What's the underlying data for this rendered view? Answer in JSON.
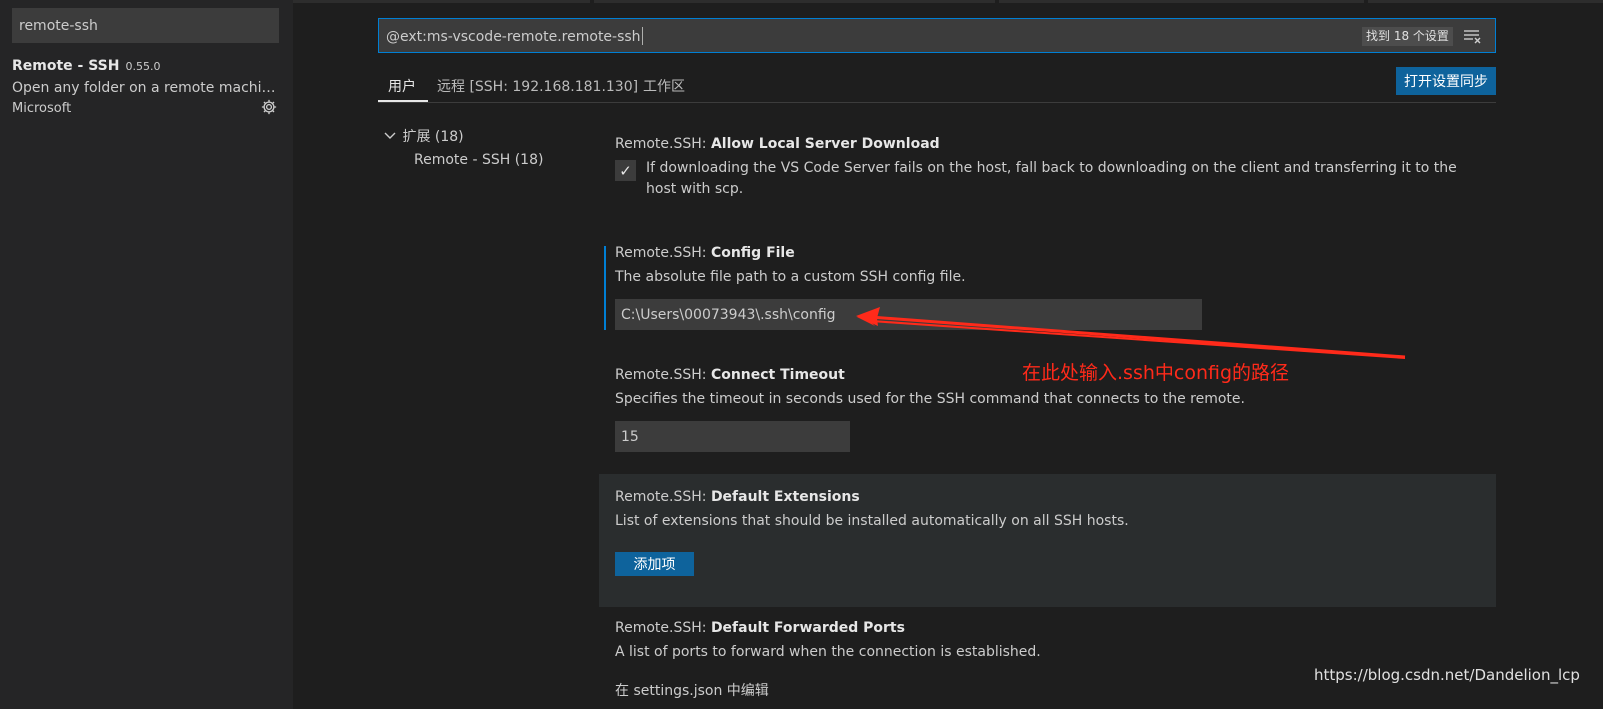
{
  "sidebar": {
    "search_value": "remote-ssh",
    "extension": {
      "name": "Remote - SSH",
      "version": "0.55.0",
      "description": "Open any folder on a remote machine...",
      "publisher": "Microsoft",
      "gear_icon": "gear-icon"
    }
  },
  "settings_search": {
    "value": "@ext:ms-vscode-remote.remote-ssh",
    "result_count": "找到 18 个设置",
    "clear_icon": "clear-filter-icon"
  },
  "scope_tabs": {
    "user": "用户",
    "remote": "远程 [SSH: 192.168.181.130]",
    "workspace": "工作区"
  },
  "sync_button": "打开设置同步",
  "toc": {
    "group": "扩展 (18)",
    "item": "Remote - SSH (18)"
  },
  "settings": [
    {
      "category": "Remote.SSH: ",
      "label": "Allow Local Server Download",
      "description": "If downloading the VS Code Server fails on the host, fall back to downloading on the client and transferring it to the host with scp.",
      "checked": true,
      "check_glyph": "✓"
    },
    {
      "category": "Remote.SSH: ",
      "label": "Config File",
      "description": "The absolute file path to a custom SSH config file.",
      "value": "C:\\Users\\00073943\\.ssh\\config"
    },
    {
      "category": "Remote.SSH: ",
      "label": "Connect Timeout",
      "description": "Specifies the timeout in seconds used for the SSH command that connects to the remote.",
      "value": "15"
    },
    {
      "category": "Remote.SSH: ",
      "label": "Default Extensions",
      "description": "List of extensions that should be installed automatically on all SSH hosts.",
      "button": "添加项"
    },
    {
      "category": "Remote.SSH: ",
      "label": "Default Forwarded Ports",
      "description": "A list of ports to forward when the connection is established.",
      "link": "在 settings.json 中编辑"
    }
  ],
  "annotation": {
    "text": "在此处输入.ssh中config的路径",
    "color": "#ff2a1a"
  },
  "watermark": "https://blog.csdn.net/Dandelion_lcp",
  "colors": {
    "accent": "#007fd4",
    "button": "#0e639c",
    "background": "#1e1e1e",
    "sidebar": "#252526"
  }
}
